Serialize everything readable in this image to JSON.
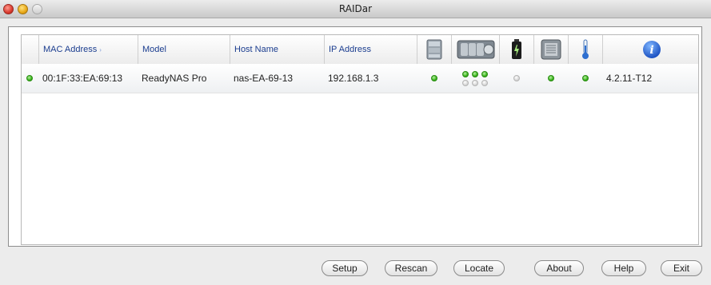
{
  "window": {
    "title": "RAIDar"
  },
  "table": {
    "columns": {
      "mac": "MAC Address",
      "model": "Model",
      "host": "Host Name",
      "ip": "IP Address"
    },
    "rows": [
      {
        "mac": "00:1F:33:EA:69:13",
        "model": "ReadyNAS Pro",
        "host": "nas-EA-69-13",
        "ip": "192.168.1.3",
        "firmware": "4.2.11-T12"
      }
    ]
  },
  "status_colors": {
    "ok": "#39b31c",
    "idle": "#d7d7d7"
  },
  "icons": [
    "volume-icon",
    "disks-icon",
    "battery-icon",
    "fan-icon",
    "temperature-icon",
    "info-icon"
  ],
  "buttons": {
    "setup": "Setup",
    "rescan": "Rescan",
    "locate": "Locate",
    "about": "About",
    "help": "Help",
    "exit": "Exit"
  }
}
